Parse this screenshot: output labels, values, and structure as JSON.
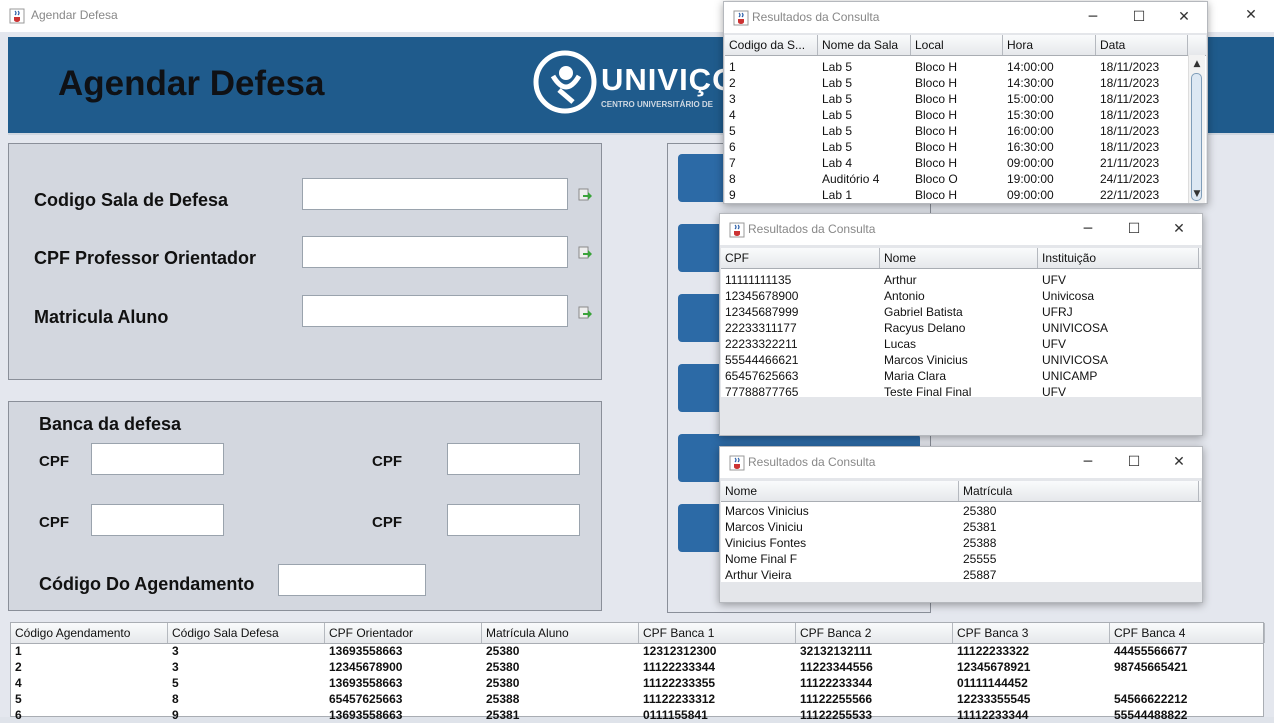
{
  "main_window": {
    "title": "Agendar Defesa",
    "heading": "Agendar Defesa",
    "logo_text": "UNIVIÇOS",
    "logo_subtext": "CENTRO UNIVERSITÁRIO DE"
  },
  "form": {
    "codigo_sala_label": "Codigo Sala de Defesa",
    "cpf_orientador_label": "CPF Professor Orientador",
    "matricula_label": "Matricula Aluno",
    "codigo_sala_value": "",
    "cpf_orientador_value": "",
    "matricula_value": ""
  },
  "banca": {
    "title": "Banca da defesa",
    "cpf_label_1": "CPF",
    "cpf_label_2": "CPF",
    "cpf_label_3": "CPF",
    "cpf_label_4": "CPF",
    "codigo_agendamento_label": "Código Do Agendamento"
  },
  "dialog_salas": {
    "title": "Resultados da Consulta",
    "columns": [
      "Codigo da S...",
      "Nome da Sala",
      "Local",
      "Hora",
      "Data"
    ],
    "rows": [
      [
        "1",
        "Lab 5",
        "Bloco H",
        "14:00:00",
        "18/11/2023"
      ],
      [
        "2",
        "Lab 5",
        "Bloco H",
        "14:30:00",
        "18/11/2023"
      ],
      [
        "3",
        "Lab 5",
        "Bloco H",
        "15:00:00",
        "18/11/2023"
      ],
      [
        "4",
        "Lab 5",
        "Bloco H",
        "15:30:00",
        "18/11/2023"
      ],
      [
        "5",
        "Lab 5",
        "Bloco H",
        "16:00:00",
        "18/11/2023"
      ],
      [
        "6",
        "Lab 5",
        "Bloco H",
        "16:30:00",
        "18/11/2023"
      ],
      [
        "7",
        "Lab 4",
        "Bloco H",
        "09:00:00",
        "21/11/2023"
      ],
      [
        "8",
        "Auditório 4",
        "Bloco O",
        "19:00:00",
        "24/11/2023"
      ],
      [
        "9",
        "Lab 1",
        "Bloco H",
        "09:00:00",
        "22/11/2023"
      ]
    ]
  },
  "dialog_professores": {
    "title": "Resultados da Consulta",
    "columns": [
      "CPF",
      "Nome",
      "Instituição"
    ],
    "rows": [
      [
        "11111111135",
        "Arthur",
        "UFV"
      ],
      [
        "12345678900",
        "Antonio",
        "Univicosa"
      ],
      [
        "12345687999",
        "Gabriel Batista",
        "UFRJ"
      ],
      [
        "22233311177",
        "Racyus Delano",
        "UNIVICOSA"
      ],
      [
        "22233322211",
        "Lucas",
        "UFV"
      ],
      [
        "55544466621",
        "Marcos Vinicius",
        "UNIVICOSA"
      ],
      [
        "65457625663",
        "Maria Clara",
        "UNICAMP"
      ],
      [
        "77788877765",
        "Teste Final Final",
        "UFV"
      ]
    ]
  },
  "dialog_alunos": {
    "title": "Resultados da Consulta",
    "columns": [
      "Nome",
      "Matrícula"
    ],
    "rows": [
      [
        "Marcos Vinicius",
        "25380"
      ],
      [
        "Marcos Viniciu",
        "25381"
      ],
      [
        "Vinicius Fontes",
        "25388"
      ],
      [
        "Nome Final F",
        "25555"
      ],
      [
        "Arthur Vieira",
        "25887"
      ]
    ]
  },
  "agendamentos_table": {
    "columns": [
      "Código Agendamento",
      "Código Sala Defesa",
      "CPF Orientador",
      "Matrícula Aluno",
      "CPF Banca 1",
      "CPF Banca 2",
      "CPF Banca 3",
      "CPF Banca 4"
    ],
    "rows": [
      [
        "1",
        "3",
        "13693558663",
        "25380",
        "12312312300",
        "32132132111",
        "11122233322",
        "44455566677"
      ],
      [
        "2",
        "3",
        "12345678900",
        "25380",
        "11122233344",
        "11223344556",
        "12345678921",
        "98745665421"
      ],
      [
        "4",
        "5",
        "13693558663",
        "25380",
        "11122233355",
        "11122233344",
        "01111144452",
        ""
      ],
      [
        "5",
        "8",
        "65457625663",
        "25388",
        "11122233312",
        "11122255566",
        "12233355545",
        "54566622212"
      ],
      [
        "6",
        "9",
        "13693558663",
        "25381",
        "0111155841",
        "11122255533",
        "11112233344",
        "55544488822"
      ]
    ]
  },
  "icons": {
    "app_icon": "java-cup-icon",
    "picker_icon": "green-arrow-lookup-icon",
    "minimize": "─",
    "maximize": "☐",
    "close": "✕"
  },
  "colors": {
    "banner": "#1f5b8c",
    "button_blue": "#2c6aa6",
    "panel": "#d3d7df"
  }
}
